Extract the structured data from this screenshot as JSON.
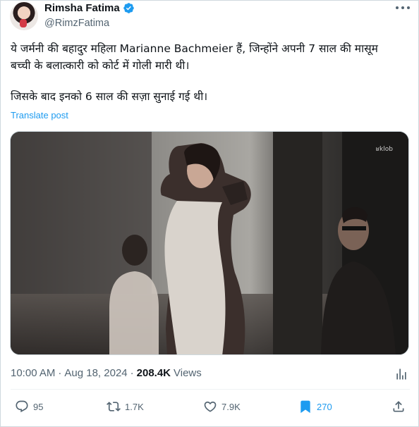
{
  "author": {
    "display_name": "Rimsha Fatima",
    "handle": "@RimzFatima",
    "verified": true
  },
  "post": {
    "lines": [
      "ये जर्मनी की बहादुर महिला Marianne Bachmeier हैं, जिन्होंने अपनी 7 साल की मासूम",
      "बच्ची के बलात्कारी को कोर्ट में गोली मारी थी।",
      "जिसके बाद इनको 6 साल की सज़ा सुनाई गई थी।"
    ],
    "translate_label": "Translate post"
  },
  "media": {
    "watermark": "ʁklob"
  },
  "meta": {
    "time": "10:00 AM",
    "separator": "·",
    "date": "Aug 18, 2024",
    "separator2": "·",
    "views_count": "208.4K",
    "views_label": "Views"
  },
  "actions": {
    "replies": "95",
    "reposts": "1.7K",
    "likes": "7.9K",
    "bookmarks": "270"
  },
  "colors": {
    "accent": "#1d9bf0",
    "text": "#0f1419",
    "secondary": "#536471"
  },
  "icons": [
    "verified-badge-icon",
    "more-icon",
    "analytics-icon",
    "reply-icon",
    "repost-icon",
    "like-icon",
    "bookmark-icon",
    "share-icon"
  ]
}
